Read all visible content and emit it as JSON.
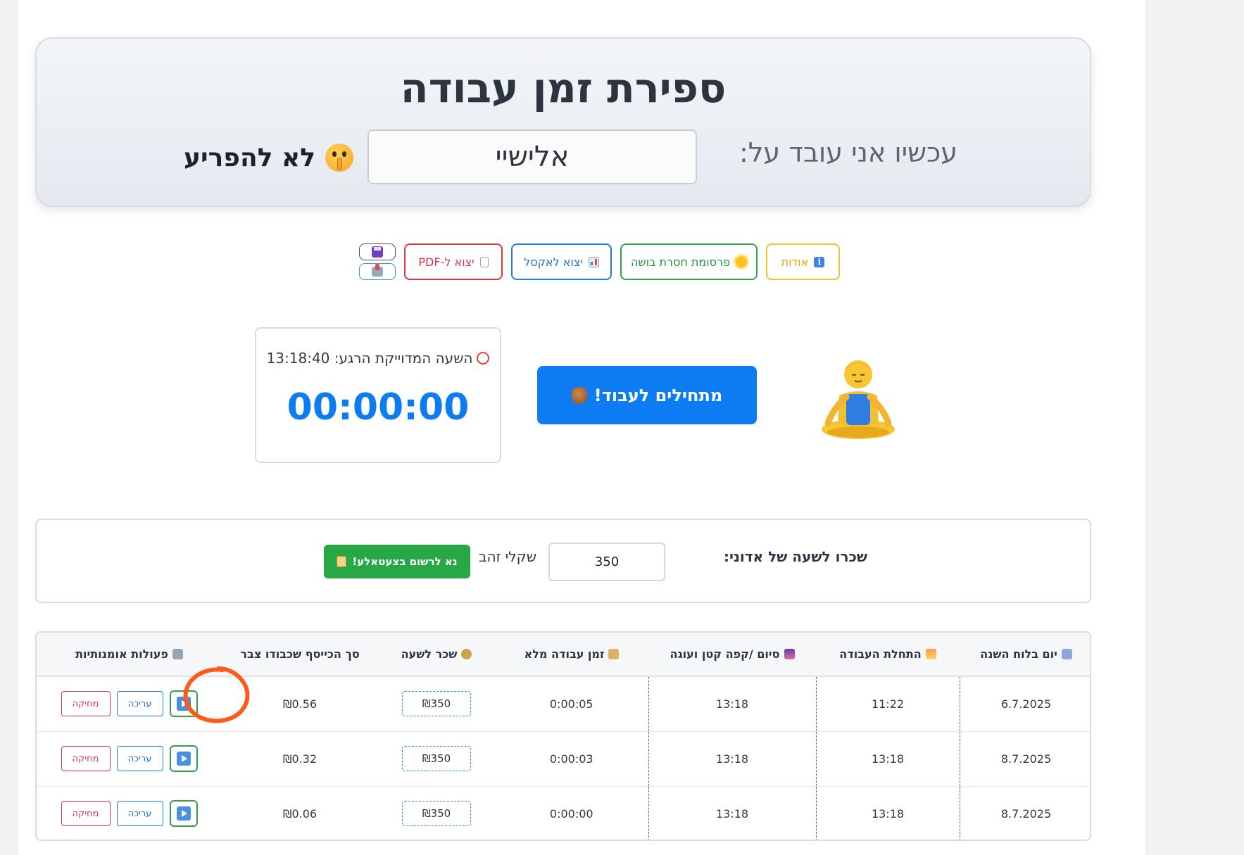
{
  "header": {
    "title": "ספירת זמן עבודה",
    "working_label": "עכשיו אני עובד על:",
    "working_value": "אלישיי",
    "dnd_text": "לא להפריע"
  },
  "toolbar": {
    "about_label": "אודות",
    "ad_label": "פרסומת חסרת בושה",
    "excel_label": "יצוא לאקסל",
    "pdf_label": "יצוא ל-PDF"
  },
  "clock": {
    "current_time_label": "השעה המדוייקת הרגע: 13:18:40",
    "timer": "00:00:00"
  },
  "start_button_label": "מתחילים לעבוד!",
  "wage": {
    "label": "שכרו לשעה של אדוני:",
    "value": "350",
    "unit": "שקלי זהב",
    "register_label": "נא לרשום בצעטאלע!"
  },
  "table": {
    "headers": [
      "יום בלוח השנה",
      "התחלת העבודה",
      "סיום /קפה קטן ועוגה",
      "זמן עבודה מלא",
      "שכר לשעה",
      "סך הכייסף שכבודו צבר",
      "פעולות אומנותיות"
    ],
    "rows": [
      {
        "date": "6.7.2025",
        "start": "11:22",
        "end": "13:18",
        "duration": "0:00:05",
        "rate": "₪350",
        "total": "₪0.56"
      },
      {
        "date": "8.7.2025",
        "start": "13:18",
        "end": "13:18",
        "duration": "0:00:03",
        "rate": "₪350",
        "total": "₪0.32"
      },
      {
        "date": "8.7.2025",
        "start": "13:18",
        "end": "13:18",
        "duration": "0:00:00",
        "rate": "₪350",
        "total": "₪0.06"
      }
    ],
    "edit_label": "עריכה",
    "delete_label": "מחיקה"
  },
  "colors": {
    "primary": "#0d7cf2",
    "success": "#28a745",
    "danger": "#dc3545",
    "warning": "#f2c12e",
    "annotation": "#ff5a1a"
  }
}
